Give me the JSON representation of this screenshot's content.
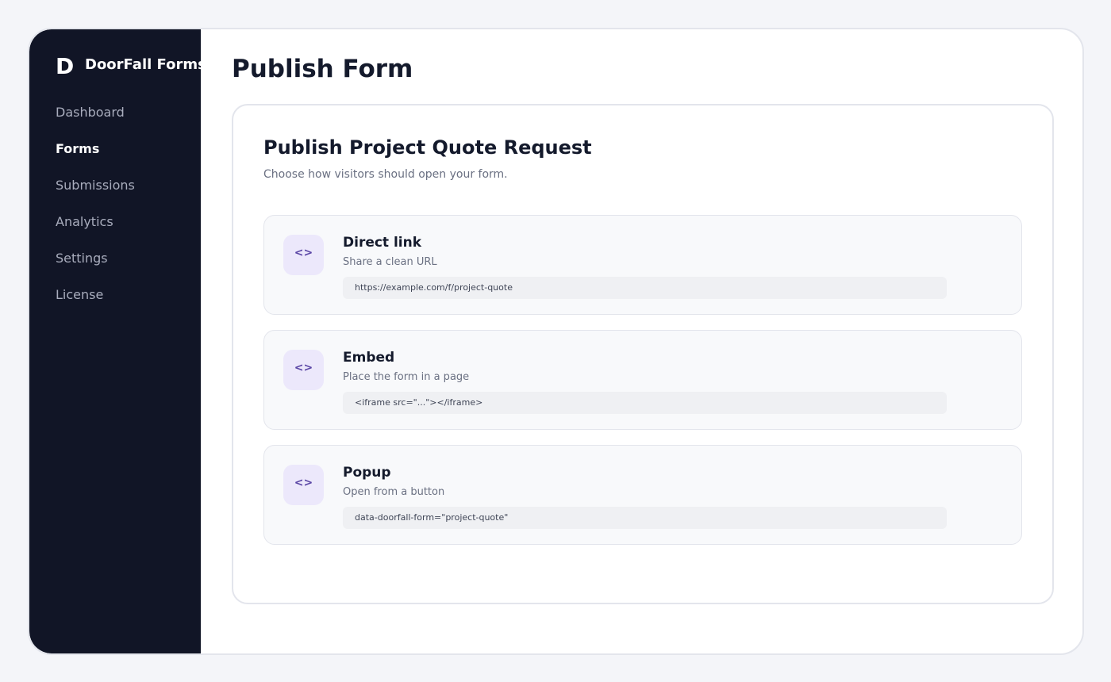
{
  "brand": {
    "logo": "D",
    "name": "DoorFall Forms"
  },
  "sidebar": {
    "items": [
      {
        "label": "Dashboard",
        "active": false
      },
      {
        "label": "Forms",
        "active": true
      },
      {
        "label": "Submissions",
        "active": false
      },
      {
        "label": "Analytics",
        "active": false
      },
      {
        "label": "Settings",
        "active": false
      },
      {
        "label": "License",
        "active": false
      }
    ]
  },
  "main": {
    "page_title": "Publish Form",
    "card": {
      "title": "Publish Project Quote Request",
      "subtitle": "Choose how visitors should open your form.",
      "options": [
        {
          "icon": "code-icon",
          "icon_glyph": "<>",
          "title": "Direct link",
          "description": "Share a clean URL",
          "code": "https://example.com/f/project-quote"
        },
        {
          "icon": "code-icon",
          "icon_glyph": "<>",
          "title": "Embed",
          "description": "Place the form in a page",
          "code": "<iframe src=\"...\"></iframe>"
        },
        {
          "icon": "code-icon",
          "icon_glyph": "<>",
          "title": "Popup",
          "description": "Open from a button",
          "code": "data-doorfall-form=\"project-quote\""
        }
      ]
    }
  },
  "colors": {
    "sidebar_bg": "#111526",
    "page_bg": "#f4f5f9",
    "accent_icon_bg": "#ece8fb",
    "accent_icon_fg": "#5b47a6",
    "heading": "#141a2c",
    "muted": "#6a7082"
  }
}
